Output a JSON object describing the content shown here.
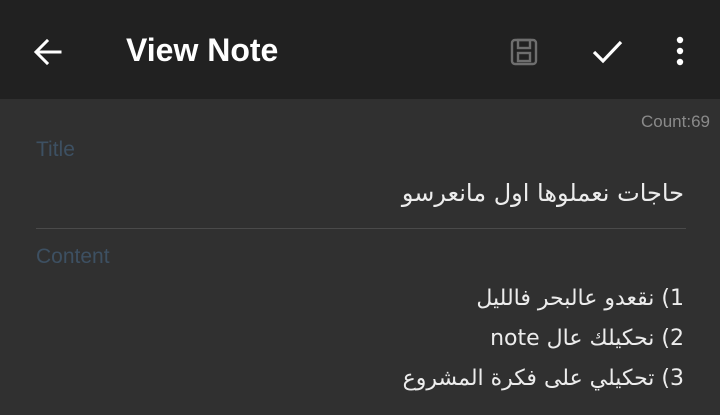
{
  "appbar": {
    "back_icon": "arrow-left-icon",
    "title": "View Note",
    "save_icon": "save-icon",
    "check_icon": "check-icon",
    "more_icon": "more-vert-icon"
  },
  "note": {
    "count": "Count:69",
    "title_label": "Title",
    "title_value": "حاجات نعملوها اول مانعرسو",
    "content_label": "Content",
    "content_lines": [
      "1) نقعدو عالبحر فالليل",
      "2) نحكيلك عال note",
      "3) تحكيلي على فكرة المشروع"
    ]
  },
  "colors": {
    "appbar_bg": "#212121",
    "body_bg": "#303030",
    "label": "#3d5062",
    "text": "#ececec",
    "muted": "#8a8a8a"
  }
}
